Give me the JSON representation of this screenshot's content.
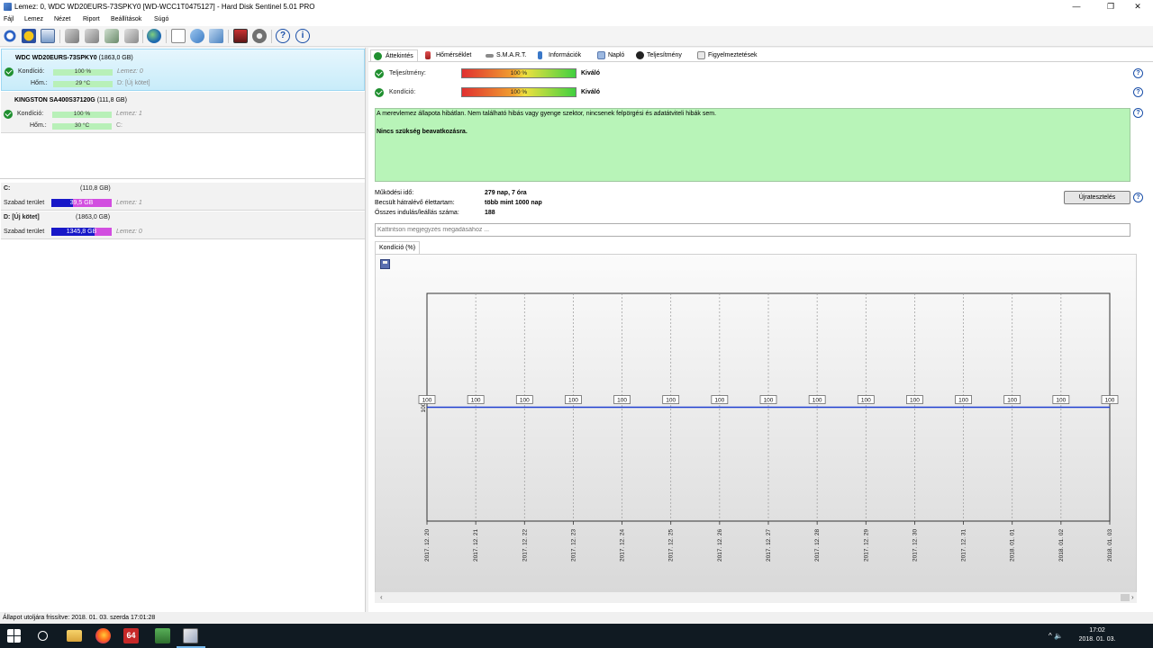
{
  "window": {
    "title": "Lemez: 0, WDC WD20EURS-73SPKY0 [WD-WCC1T0475127]  -  Hard Disk Sentinel 5.01 PRO",
    "minimize": "—",
    "restore": "❐",
    "close": "✕"
  },
  "menu": [
    "Fájl",
    "Lemez",
    "Nézet",
    "Riport",
    "Beállítások",
    "Súgó"
  ],
  "toolbar_icons": [
    "refresh-icon",
    "disk-overview-icon",
    "mail-icon",
    "drive-icon-1",
    "drive-icon-2",
    "drive-icon-3",
    "drive-icon-4",
    "globe-icon",
    "report-icon",
    "sync-icon",
    "network-icon",
    "monitor-icon",
    "gear-icon",
    "help-icon",
    "info-icon"
  ],
  "disks": [
    {
      "name": "WDC WD20EURS-73SPKY0",
      "size": "(1863,0 GB)",
      "condition_label": "Kondíció:",
      "condition_value": "100 %",
      "condition_level": 1.0,
      "temp_label": "Hőm.:",
      "temp_value": "29 °C",
      "disk_ref": "Lemez: 0",
      "volume_ref": "D: [Új kötet]"
    },
    {
      "name": "KINGSTON SA400S37120G",
      "size": "(111,8 GB)",
      "condition_label": "Kondíció:",
      "condition_value": "100 %",
      "condition_level": 1.0,
      "temp_label": "Hőm.:",
      "temp_value": "30 °C",
      "disk_ref": "Lemez: 1",
      "volume_ref": "C:"
    }
  ],
  "volumes": [
    {
      "name": "C:",
      "size": "(110,8 GB)",
      "free_label": "Szabad terület",
      "free_value": "39,5 GB",
      "free_ratio": 0.356,
      "disk_ref": "Lemez: 1"
    },
    {
      "name": "D: [Új kötet]",
      "size": "(1863,0 GB)",
      "free_label": "Szabad terület",
      "free_value": "1345,8 GB",
      "free_ratio": 0.722,
      "disk_ref": "Lemez: 0"
    }
  ],
  "tabs": [
    {
      "label": "Áttekintés",
      "icon": "check-circle-icon",
      "active": true
    },
    {
      "label": "Hőmérséklet",
      "icon": "thermometer-icon",
      "active": false
    },
    {
      "label": "S.M.A.R.T.",
      "icon": "smart-icon",
      "active": false
    },
    {
      "label": "Információk",
      "icon": "info-icon",
      "active": false
    },
    {
      "label": "Napló",
      "icon": "log-icon",
      "active": false
    },
    {
      "label": "Teljesítmény",
      "icon": "performance-icon",
      "active": false
    },
    {
      "label": "Figyelmeztetések",
      "icon": "alert-icon",
      "active": false
    }
  ],
  "overview": {
    "performance_label": "Teljesítmény:",
    "performance_value": "100 %",
    "performance_status": "Kiváló",
    "condition_label": "Kondíció:",
    "condition_value": "100 %",
    "condition_status": "Kiváló",
    "message_line1": "A merevlemez állapota hibátlan. Nem található hibás vagy gyenge szektor, nincsenek felpörgési és adatátviteli hibák sem.",
    "message_line2": "Nincs szükség beavatkozásra.",
    "uptime_label": "Működési idő:",
    "uptime_value": "279 nap, 7 óra",
    "lifetime_label": "Becsült hátralévő élettartam:",
    "lifetime_value": "több mint 1000 nap",
    "startstop_label": "Összes indulás/leállás száma:",
    "startstop_value": "188",
    "retest_button": "Újratesztelés",
    "comment_placeholder": "Kattintson megjegyzés megadásához ...",
    "help": "?"
  },
  "chart_tab_label": "Kondíció  (%)",
  "chart_data": {
    "type": "line",
    "title": "",
    "xlabel": "",
    "ylabel": "",
    "x": [
      "2017. 12. 20",
      "2017. 12. 21",
      "2017. 12. 22",
      "2017. 12. 23",
      "2017. 12. 24",
      "2017. 12. 25",
      "2017. 12. 26",
      "2017. 12. 27",
      "2017. 12. 28",
      "2017. 12. 29",
      "2017. 12. 30",
      "2017. 12. 31",
      "2018. 01. 01",
      "2018. 01. 02",
      "2018. 01. 03"
    ],
    "series": [
      {
        "values": [
          100,
          100,
          100,
          100,
          100,
          100,
          100,
          100,
          100,
          100,
          100,
          100,
          100,
          100,
          100
        ],
        "color": "#1f3fd0"
      }
    ],
    "y_tick": "100",
    "ylim": [
      0,
      200
    ],
    "grid": true
  },
  "statusbar": "Állapot utoljára frissítve: 2018. 01. 03. szerda 17:01:28",
  "taskbar": {
    "apps": [
      "windows-start-icon",
      "search-icon",
      "file-explorer-icon",
      "firefox-icon",
      "aida64-icon",
      "terminal-icon",
      "hard-disk-sentinel-icon"
    ],
    "aida_label": "64",
    "tray_symbols": "^  🔈",
    "time": "17:02",
    "date": "2018. 01. 03."
  }
}
